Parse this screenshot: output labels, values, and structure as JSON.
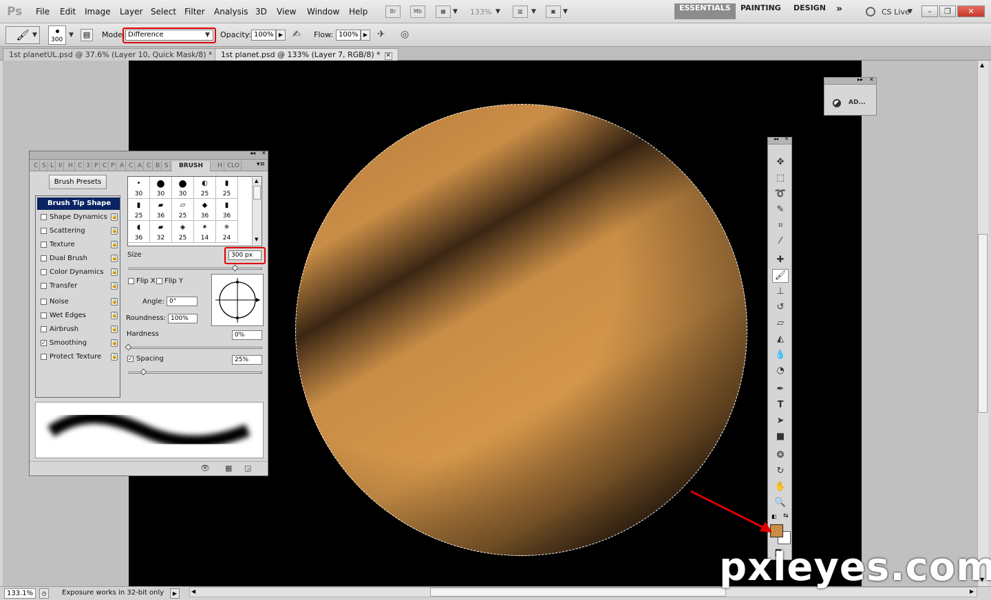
{
  "app": {
    "logo": "Ps"
  },
  "menu": {
    "items": [
      "File",
      "Edit",
      "Image",
      "Layer",
      "Select",
      "Filter",
      "Analysis",
      "3D",
      "View",
      "Window",
      "Help"
    ]
  },
  "appbar": {
    "bridge": "Br",
    "minibridge": "Mb",
    "zoom": "133%",
    "workspaces": [
      "ESSENTIALS",
      "PAINTING",
      "DESIGN"
    ],
    "more": "»",
    "cslive": "CS Live"
  },
  "options": {
    "brush_size": "300",
    "mode_label": "Mode:",
    "mode_value": "Difference",
    "opacity_label": "Opacity:",
    "opacity_value": "100%",
    "flow_label": "Flow:",
    "flow_value": "100%"
  },
  "tabs": [
    {
      "label": "1st planetUL.psd @ 37.6% (Layer 10, Quick Mask/8) *"
    },
    {
      "label": "1st planet.psd @ 133% (Layer 7, RGB/8) *"
    }
  ],
  "brush_panel": {
    "tabs": [
      "C",
      "S",
      "L",
      "II",
      "H",
      "C",
      "3",
      "P",
      "C",
      "P",
      "A",
      "C",
      "A",
      "C",
      "B",
      "S",
      "BRUSH",
      "H",
      "CLO"
    ],
    "presets_button": "Brush Presets",
    "options": [
      {
        "label": "Brush Tip Shape",
        "checked": null,
        "selected": true
      },
      {
        "label": "Shape Dynamics",
        "checked": false
      },
      {
        "label": "Scattering",
        "checked": false
      },
      {
        "label": "Texture",
        "checked": false
      },
      {
        "label": "Dual Brush",
        "checked": false
      },
      {
        "label": "Color Dynamics",
        "checked": false
      },
      {
        "label": "Transfer",
        "checked": false
      },
      {
        "label": "Noise",
        "checked": false
      },
      {
        "label": "Wet Edges",
        "checked": false
      },
      {
        "label": "Airbrush",
        "checked": false
      },
      {
        "label": "Smoothing",
        "checked": true
      },
      {
        "label": "Protect Texture",
        "checked": false
      }
    ],
    "tips": [
      {
        "glyph": "•",
        "size": "30"
      },
      {
        "glyph": "●",
        "size": "30"
      },
      {
        "glyph": "●",
        "size": "30"
      },
      {
        "glyph": "◐",
        "size": "25"
      },
      {
        "glyph": "▮",
        "size": "25"
      },
      {
        "glyph": "▮",
        "size": "25"
      },
      {
        "glyph": "▰",
        "size": "36"
      },
      {
        "glyph": "▱",
        "size": "25"
      },
      {
        "glyph": "◆",
        "size": "36"
      },
      {
        "glyph": "▮",
        "size": "36"
      },
      {
        "glyph": "◖",
        "size": "36"
      },
      {
        "glyph": "▰",
        "size": "32"
      },
      {
        "glyph": "◈",
        "size": "25"
      },
      {
        "glyph": "✶",
        "size": "14"
      },
      {
        "glyph": "✳",
        "size": "24"
      }
    ],
    "size_label": "Size",
    "size_value": "300 px",
    "flipx_label": "Flip X",
    "flipy_label": "Flip Y",
    "angle_label": "Angle:",
    "angle_value": "0°",
    "roundness_label": "Roundness:",
    "roundness_value": "100%",
    "hardness_label": "Hardness",
    "hardness_value": "0%",
    "spacing_label": "Spacing",
    "spacing_value": "25%",
    "spacing_checked": true
  },
  "adjustments_panel": {
    "label": "AD..."
  },
  "status": {
    "zoom": "133.1%",
    "info": "Exposure works in 32-bit only"
  },
  "colors": {
    "foreground": "#c98d46",
    "background": "#ffffff",
    "highlight": "#e10000"
  },
  "watermark": "pxleyes.com"
}
